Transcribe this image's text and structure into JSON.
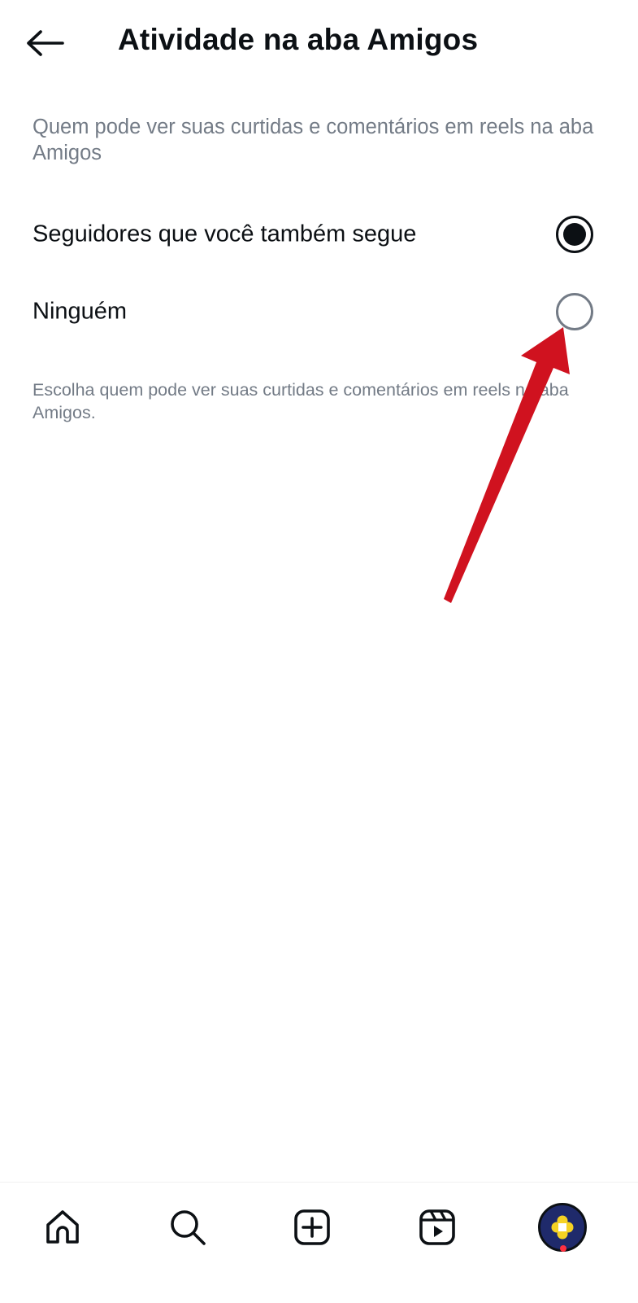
{
  "header": {
    "title": "Atividade na aba Amigos",
    "back_icon": "arrow-left-icon"
  },
  "section": {
    "heading": "Quem pode ver suas curtidas e comentários em reels na aba Amigos",
    "options": [
      {
        "label": "Seguidores que você também segue",
        "selected": true
      },
      {
        "label": "Ninguém",
        "selected": false
      }
    ],
    "help_text": "Escolha quem pode ver suas curtidas e comentários em reels na aba Amigos."
  },
  "bottom_nav": {
    "items": [
      {
        "icon": "home-icon"
      },
      {
        "icon": "search-icon"
      },
      {
        "icon": "create-post-icon"
      },
      {
        "icon": "reels-icon"
      },
      {
        "icon": "profile-avatar"
      }
    ],
    "has_notification_dot": true
  },
  "colors": {
    "primary_text": "#0c1014",
    "secondary_text": "#737b86",
    "annotation_arrow": "#d0121f",
    "notification_dot": "#ff3040",
    "avatar_background": "#1f2a6b",
    "avatar_accent": "#f6d223"
  }
}
